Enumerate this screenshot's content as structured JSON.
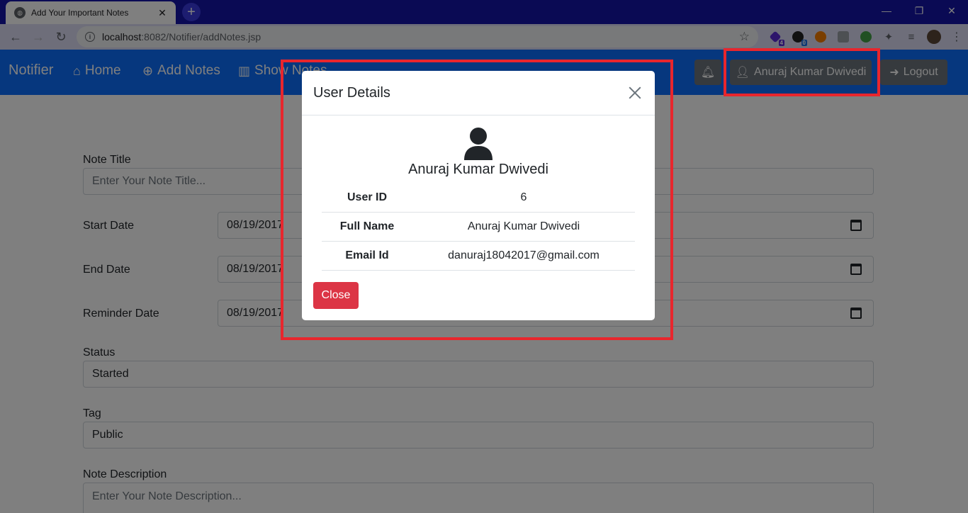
{
  "browser": {
    "tab_title": "Add Your Important Notes",
    "tab_close": "✕",
    "new_tab": "+",
    "url_host": "localhost",
    "url_rest": ":8082/Notifier/addNotes.jsp",
    "badge_1": "4",
    "badge_2": "0"
  },
  "navbar": {
    "brand": "Notifier",
    "home": "Home",
    "add_notes": "Add Notes",
    "show_notes": "Show Notes",
    "user_button": "Anuraj Kumar Dwivedi",
    "logout": "Logout"
  },
  "form": {
    "note_title_label": "Note Title",
    "note_title_placeholder": "Enter Your Note Title...",
    "start_date_label": "Start Date",
    "start_date_value": "08/19/2017",
    "end_date_label": "End Date",
    "end_date_value": "08/19/2017",
    "reminder_date_label": "Reminder Date",
    "reminder_date_value": "08/19/2017",
    "status_label": "Status",
    "status_value": "Started",
    "tag_label": "Tag",
    "tag_value": "Public",
    "description_label": "Note Description",
    "description_placeholder": "Enter Your Note Description..."
  },
  "modal": {
    "title": "User Details",
    "user_name": "Anuraj Kumar Dwivedi",
    "rows": [
      {
        "key": "User ID",
        "value": "6"
      },
      {
        "key": "Full Name",
        "value": "Anuraj Kumar Dwivedi"
      },
      {
        "key": "Email Id",
        "value": "danuraj18042017@gmail.com"
      }
    ],
    "close_label": "Close"
  },
  "colors": {
    "navbar": "#0d6efd",
    "tabbar": "#1414a8",
    "annotation": "#e8262d",
    "close_button": "#dc3545"
  }
}
